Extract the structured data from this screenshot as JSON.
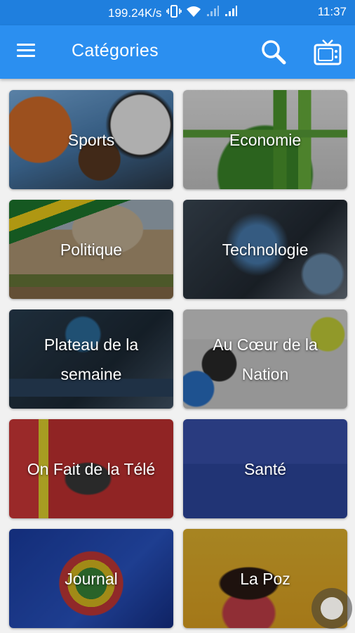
{
  "status_bar": {
    "network_speed": "199.24K/s",
    "time": "11:37",
    "icons": [
      "vibrate-icon",
      "wifi-icon",
      "signal-icon",
      "signal-icon"
    ]
  },
  "app_bar": {
    "title": "Catégories",
    "menu_icon": "hamburger-menu-icon",
    "search_icon": "search-icon",
    "tv_icon": "tv-icon",
    "color": "#2b8ff0"
  },
  "categories": [
    {
      "label": "Sports"
    },
    {
      "label": "Economie"
    },
    {
      "label": "Politique"
    },
    {
      "label": "Technologie"
    },
    {
      "label": "Plateau de la semaine"
    },
    {
      "label": "Au Cœur de la Nation"
    },
    {
      "label": "On Fait de la Télé"
    },
    {
      "label": "Santé"
    },
    {
      "label": "Journal"
    },
    {
      "label": "La Poz"
    }
  ]
}
